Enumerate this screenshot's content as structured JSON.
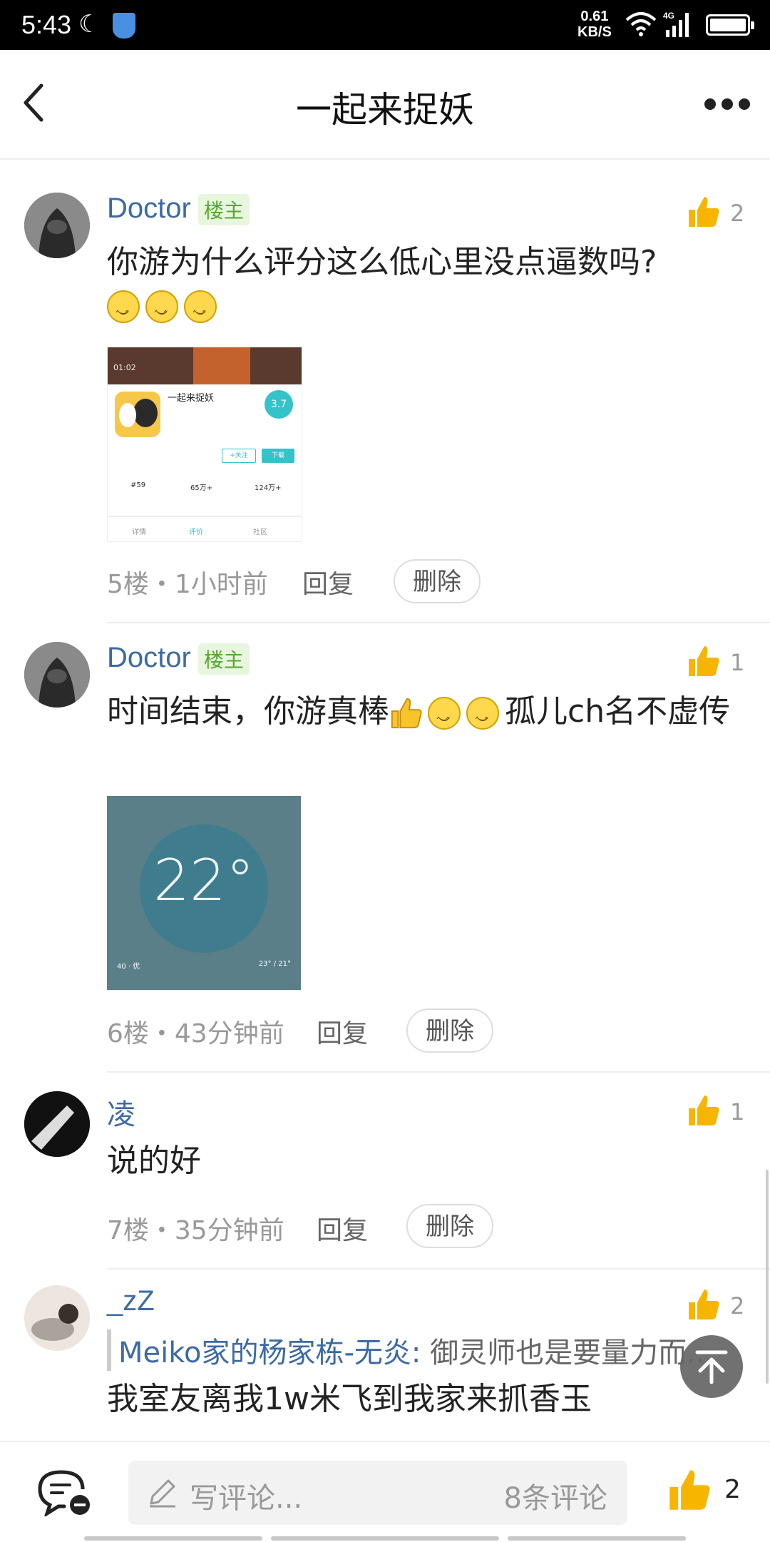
{
  "status": {
    "time": "5:43",
    "speed_value": "0.61",
    "speed_unit": "KB/S",
    "network": "4G"
  },
  "header": {
    "title": "一起来捉妖"
  },
  "comments": [
    {
      "user": "Doctor",
      "badge": "楼主",
      "likes": "2",
      "text": "你游为什么评分这么低心里没点逼数吗?",
      "emoji_count": 3,
      "floor_time": "5楼・1小时前",
      "reply": "回复",
      "delete": "删除",
      "image": {
        "time": "01:02",
        "app_name": "一起来捉妖",
        "rating": "3.7",
        "follow": "+关注",
        "download": "下载",
        "rank": "#59",
        "downloads": "65万+",
        "fans": "124万+",
        "tab_detail": "详情",
        "tab_review": "评价",
        "tab_community": "社区"
      }
    },
    {
      "user": "Doctor",
      "badge": "楼主",
      "likes": "1",
      "text_a": "时间结束，你游真棒",
      "text_b": "孤儿ch名不虚传",
      "floor_time": "6楼・43分钟前",
      "reply": "回复",
      "delete": "删除",
      "image": {
        "temp": "22°",
        "aqi": "40 · 优",
        "range": "23° / 21°"
      }
    },
    {
      "user": "凌",
      "likes": "1",
      "text": "说的好",
      "floor_time": "7楼・35分钟前",
      "reply": "回复",
      "delete": "删除"
    },
    {
      "user": "_zZ",
      "likes": "2",
      "quote_name": "Meiko家的杨家栋-无炎:",
      "quote_text": " 御灵师也是要量力而...",
      "text": "我室友离我1w米飞到我家来抓香玉"
    }
  ],
  "bottom": {
    "placeholder": "写评论...",
    "count": "8条评论",
    "likes": "2"
  },
  "colors": {
    "username": "#3c6aa5",
    "badge_text": "#56a82f",
    "like_icon": "#f7b500"
  }
}
